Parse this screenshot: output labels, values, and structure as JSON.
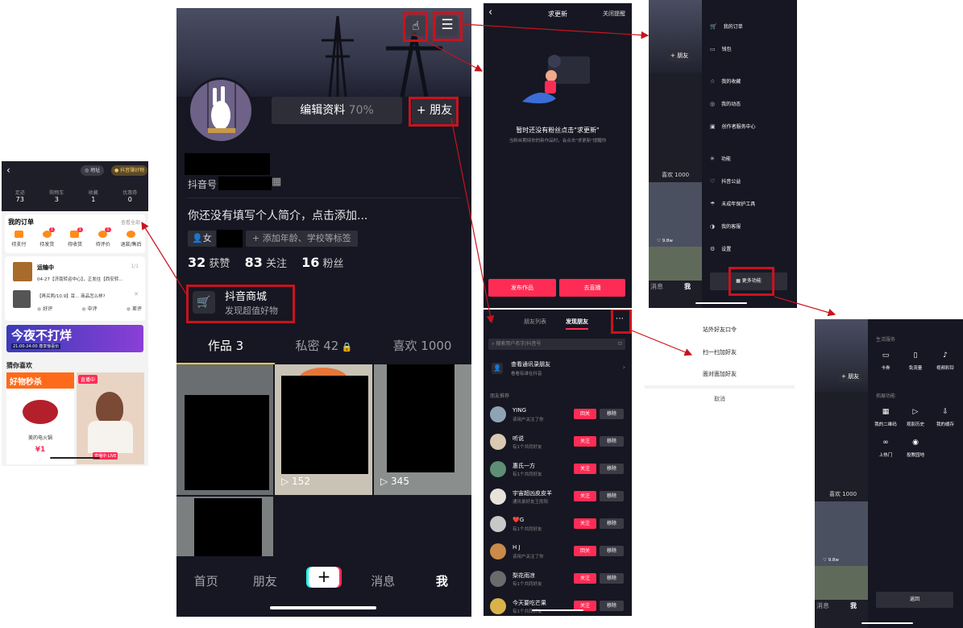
{
  "colors": {
    "accent": "#fe2c55",
    "annotation": "#c8131e",
    "dark_bg": "#161722",
    "orange": "#ff7a00"
  },
  "shop": {
    "back_icon": "chevron-left-icon",
    "pill_address": "地址",
    "pill_good": "抖音赚好物",
    "stats": [
      {
        "label": "足迹",
        "value": "73"
      },
      {
        "label": "购物车",
        "value": "3"
      },
      {
        "label": "收藏",
        "value": "1"
      },
      {
        "label": "优惠券",
        "value": "0"
      }
    ],
    "orders_title": "我的订单",
    "orders_all": "查看全部",
    "order_types": [
      {
        "label": "待支付",
        "badge": ""
      },
      {
        "label": "待发货",
        "badge": "1"
      },
      {
        "label": "待收货",
        "badge": "1"
      },
      {
        "label": "待评价",
        "badge": "1"
      },
      {
        "label": "退款/售后",
        "badge": ""
      }
    ],
    "shipping_title": "运输中",
    "shipping_count": "1/1",
    "shipping_desc": "04-27【济南转运中心】，正发往【西安转...",
    "review_q": "【再买两/10.9】耳... 商品怎么样?",
    "review_opts": [
      "好评",
      "中评",
      "差评"
    ],
    "banner_title": "今夜不打烊",
    "banner_sub": "21:00-24:00  尊享惊喜价",
    "guess_title": "猜你喜欢",
    "card1_tag": "好物秒杀",
    "card1_name": "美的电火锅",
    "card1_price": "¥1",
    "card2_tag": "直播中",
    "card2_live": "直播中 LIVE"
  },
  "profile": {
    "gesture_icon": "hand-pointer-icon",
    "menu_icon": "hamburger-menu-icon",
    "edit_label": "编辑资料",
    "edit_percent": "70%",
    "add_friend": "+ 朋友",
    "douyin_id_label": "抖音号",
    "bio": "你还没有填写个人简介，点击添加...",
    "gender": "女",
    "add_tags": "+ 添加年龄、学校等标签",
    "likes_num": "32",
    "likes_label": "获赞",
    "following_num": "83",
    "following_label": "关注",
    "fans_num": "16",
    "fans_label": "粉丝",
    "shop_title": "抖音商城",
    "shop_sub": "发现超值好物",
    "tabs": [
      "作品 3",
      "私密 42",
      "喜欢 1000"
    ],
    "video_views": [
      "152",
      "345"
    ],
    "nav": [
      "首页",
      "朋友",
      "+",
      "消息",
      "我"
    ]
  },
  "request": {
    "title": "求更新",
    "close": "关闭提醒",
    "empty_title": "暂时还没有粉丝点击\"求更新\"",
    "empty_sub": "当粉丝期待你的新作品时，会点击\"求更新\"提醒你",
    "publish": "发布作品",
    "live": "去直播"
  },
  "friends": {
    "tab_list": "朋友列表",
    "tab_discover": "发现朋友",
    "search_placeholder": "搜索用户名字/抖音号",
    "contacts_title": "查看通讯录朋友",
    "contacts_sub": "看看有谁在抖音",
    "rec_title": "朋友推荐",
    "users": [
      {
        "name": "YING",
        "sub": "该用户关注了你",
        "action": "回关"
      },
      {
        "name": "听说",
        "sub": "有1个共同好友",
        "action": "关注"
      },
      {
        "name": "惠氏一方",
        "sub": "有1个共同好友",
        "action": "关注"
      },
      {
        "name": "宇宙超凶皮皮羊",
        "sub": "通讯录好友王雨阳",
        "action": "关注"
      },
      {
        "name": "❤️G",
        "sub": "有1个共同好友",
        "action": "关注"
      },
      {
        "name": "H J",
        "sub": "该用户关注了你",
        "action": "回关"
      },
      {
        "name": "梨花雨凉",
        "sub": "有1个共同好友",
        "action": "关注"
      },
      {
        "name": "今天要吃芒果",
        "sub": "有1个共同好友",
        "action": "关注"
      }
    ],
    "remove": "移除"
  },
  "sheet": {
    "items": [
      "站外好友口令",
      "扫一扫加好友",
      "面对面加好友"
    ],
    "cancel": "取消"
  },
  "menu": {
    "bg_addfriend": "+ 朋友",
    "bg_likes": "喜欢 1000",
    "bg_views": "9.8w",
    "bg_msg": "消息",
    "bg_me": "我",
    "items": [
      {
        "label": "我的订单",
        "icon": "cart-icon"
      },
      {
        "label": "钱包",
        "icon": "wallet-icon"
      },
      {
        "label": "我的收藏",
        "icon": "star-icon"
      },
      {
        "label": "我的动态",
        "icon": "activity-icon"
      },
      {
        "label": "创作者服务中心",
        "icon": "creator-icon"
      },
      {
        "label": "功能",
        "icon": "sparkle-icon"
      },
      {
        "label": "抖音公益",
        "icon": "heart-hand-icon"
      },
      {
        "label": "未成年保护工具",
        "icon": "umbrella-icon"
      },
      {
        "label": "我的客服",
        "icon": "headset-icon"
      },
      {
        "label": "设置",
        "icon": "settings-icon"
      }
    ],
    "more": "更多功能"
  },
  "more": {
    "bg_addfriend": "+ 朋友",
    "bg_likes": "喜欢 1000",
    "bg_views": "9.8w",
    "bg_msg": "消息",
    "bg_me": "我",
    "sec1": "生活服务",
    "sec1_items": [
      {
        "label": "卡券",
        "icon": "ticket-icon"
      },
      {
        "label": "免流量",
        "icon": "data-icon"
      },
      {
        "label": "视频彩铃",
        "icon": "bell-icon"
      }
    ],
    "sec2": "拓展功能",
    "sec2_items": [
      {
        "label": "我的二维码",
        "icon": "qrcode-icon"
      },
      {
        "label": "观影历史",
        "icon": "history-icon"
      },
      {
        "label": "我的缓存",
        "icon": "download-icon"
      },
      {
        "label": "上热门",
        "icon": "dou-plus-icon"
      },
      {
        "label": "投教园地",
        "icon": "education-icon"
      }
    ],
    "back": "返回"
  }
}
